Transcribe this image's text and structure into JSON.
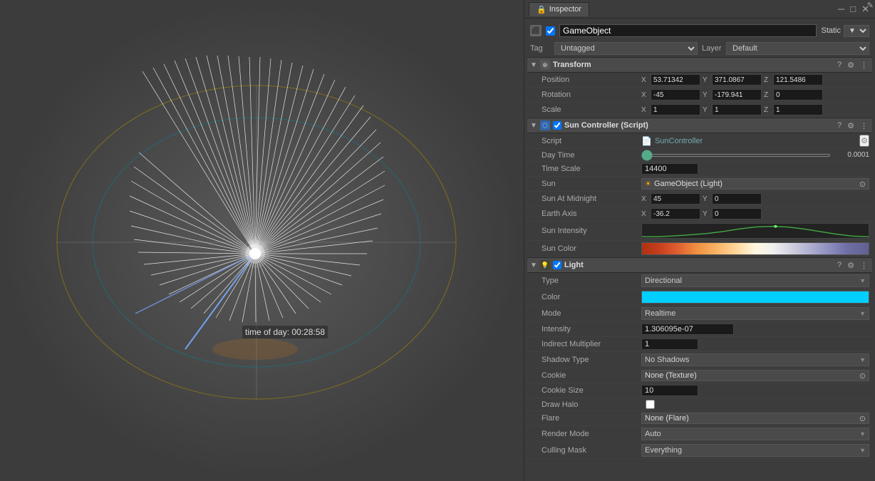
{
  "viewport": {
    "time_label": "time of day: 00:28:58"
  },
  "inspector": {
    "tab_label": "Inspector",
    "window_controls": [
      "─",
      "□",
      "✕"
    ],
    "gameobject": {
      "name": "GameObject",
      "tag": "Untagged",
      "layer": "Default",
      "static_label": "Static",
      "checkbox_checked": true
    },
    "transform": {
      "title": "Transform",
      "position": {
        "x": "53.71342",
        "y": "371.0867",
        "z": "121.5486"
      },
      "rotation": {
        "x": "-45",
        "y": "-179.941",
        "z": "0"
      },
      "scale": {
        "x": "1",
        "y": "1",
        "z": "1"
      }
    },
    "sun_controller": {
      "title": "Sun Controller (Script)",
      "script_name": "SunController",
      "day_time_label": "Day Time",
      "day_time_value": "0.0001",
      "time_scale_label": "Time Scale",
      "time_scale_value": "14400",
      "sun_label": "Sun",
      "sun_value": "GameObject (Light)",
      "sun_at_midnight_label": "Sun At Midnight",
      "sun_at_midnight_x": "45",
      "sun_at_midnight_y": "0",
      "earth_axis_label": "Earth Axis",
      "earth_axis_x": "-36.2",
      "earth_axis_y": "0",
      "sun_intensity_label": "Sun Intensity",
      "sun_color_label": "Sun Color"
    },
    "light": {
      "title": "Light",
      "type_label": "Type",
      "type_value": "Directional",
      "color_label": "Color",
      "mode_label": "Mode",
      "mode_value": "Realtime",
      "intensity_label": "Intensity",
      "intensity_value": "1.306095e-07",
      "indirect_multiplier_label": "Indirect Multiplier",
      "indirect_multiplier_value": "1",
      "shadow_type_label": "Shadow Type",
      "shadow_type_value": "No Shadows",
      "cookie_label": "Cookie",
      "cookie_value": "None (Texture)",
      "cookie_size_label": "Cookie Size",
      "cookie_size_value": "10",
      "draw_halo_label": "Draw Halo",
      "flare_label": "Flare",
      "flare_value": "None (Flare)",
      "render_mode_label": "Render Mode",
      "render_mode_value": "Auto",
      "culling_mask_label": "Culling Mask",
      "culling_mask_value": "Everything"
    }
  }
}
